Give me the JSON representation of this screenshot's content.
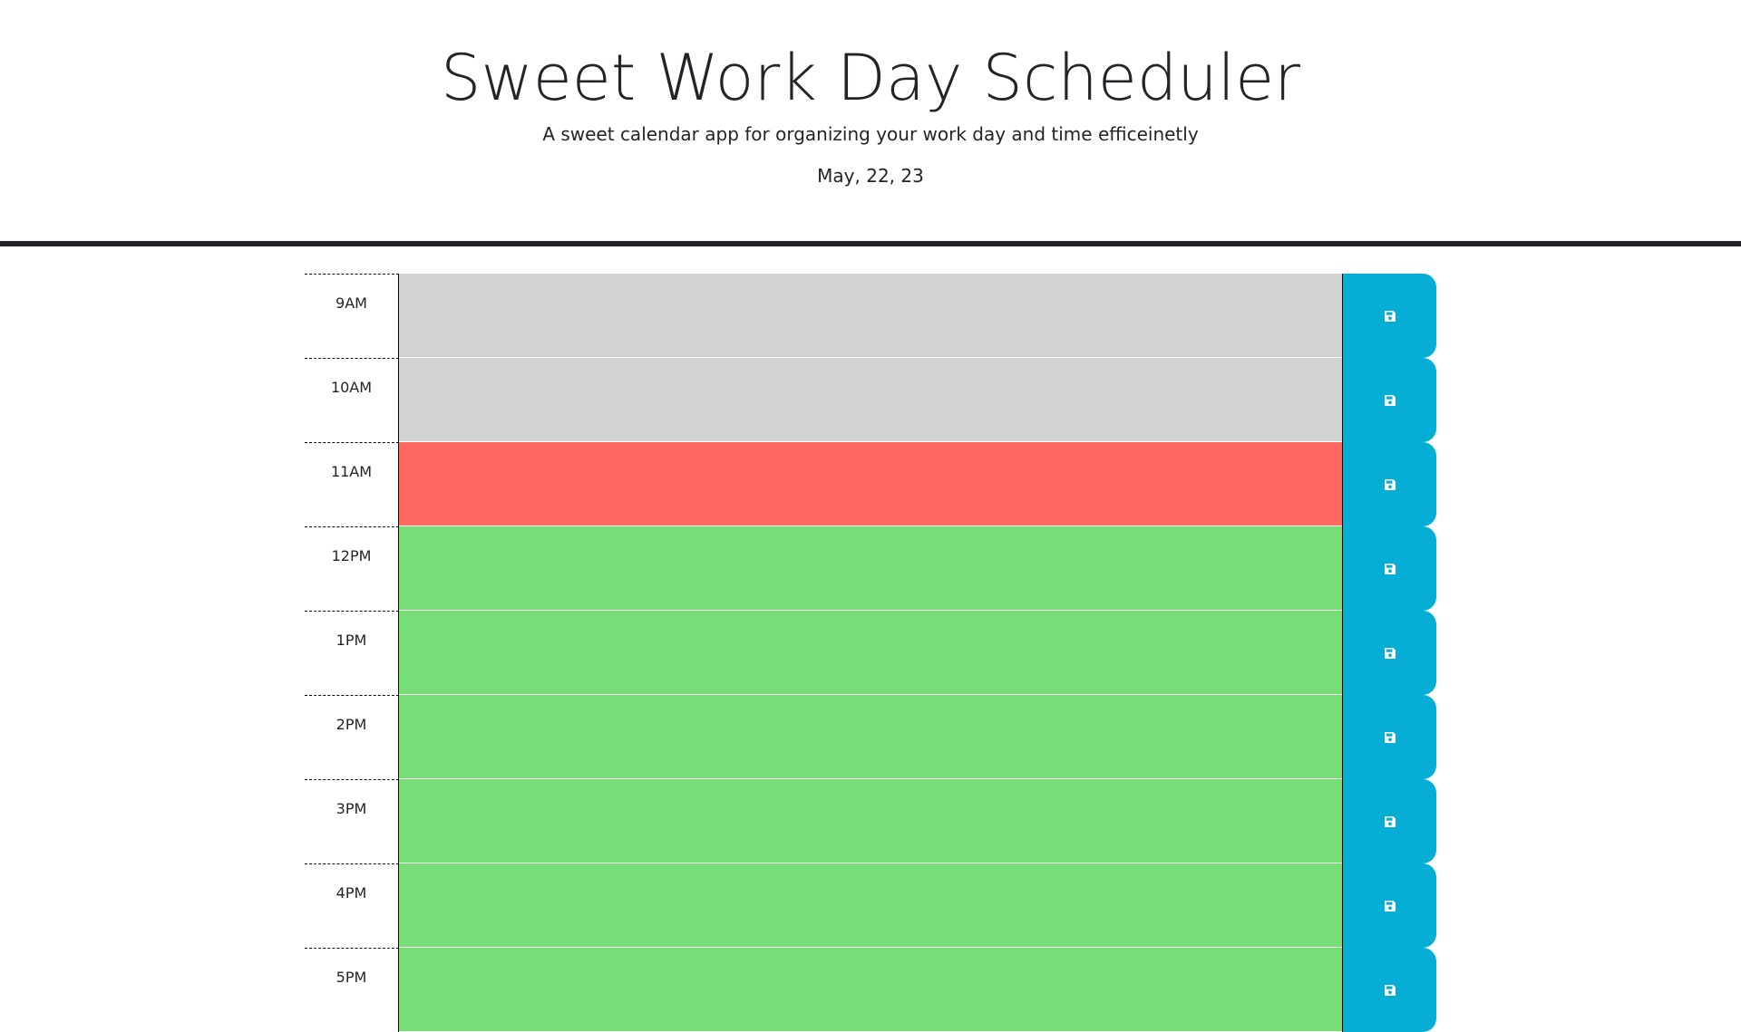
{
  "header": {
    "title": "Sweet Work Day Scheduler",
    "subtitle": "A sweet calendar app for organizing your work day and time efficeinetly",
    "date": "May, 22, 23"
  },
  "colors": {
    "past": "#d3d3d3",
    "present": "#ff6961",
    "future": "#77dd77",
    "save": "#06aed5"
  },
  "save_icon": "floppy-disk-icon",
  "rows": [
    {
      "hour": "9AM",
      "state": "past",
      "text": ""
    },
    {
      "hour": "10AM",
      "state": "past",
      "text": ""
    },
    {
      "hour": "11AM",
      "state": "present",
      "text": ""
    },
    {
      "hour": "12PM",
      "state": "future",
      "text": ""
    },
    {
      "hour": "1PM",
      "state": "future",
      "text": ""
    },
    {
      "hour": "2PM",
      "state": "future",
      "text": ""
    },
    {
      "hour": "3PM",
      "state": "future",
      "text": ""
    },
    {
      "hour": "4PM",
      "state": "future",
      "text": ""
    },
    {
      "hour": "5PM",
      "state": "future",
      "text": ""
    }
  ]
}
